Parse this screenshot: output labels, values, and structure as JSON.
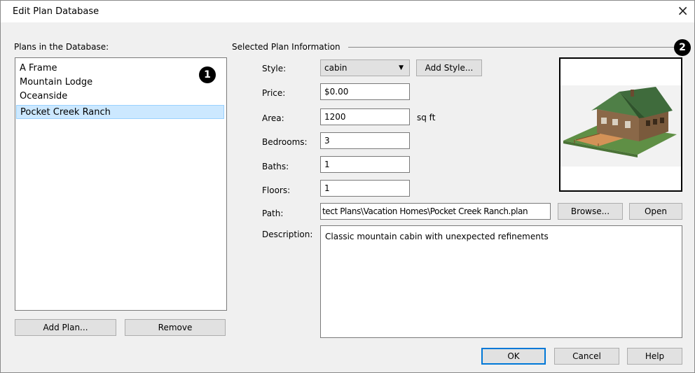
{
  "window": {
    "title": "Edit Plan Database",
    "close_glyph": "×"
  },
  "plans": {
    "header": "Plans in the Database:",
    "items": [
      "A Frame",
      "Mountain Lodge",
      "Oceanside",
      "Pocket Creek Ranch"
    ],
    "selected": "Pocket Creek Ranch",
    "add_label": "Add Plan...",
    "remove_label": "Remove"
  },
  "info": {
    "header": "Selected Plan Information",
    "style_label": "Style:",
    "style_value": "cabin",
    "add_style_label": "Add Style...",
    "price_label": "Price:",
    "price_value": "$0.00",
    "area_label": "Area:",
    "area_value": "1200",
    "area_unit": "sq ft",
    "bedrooms_label": "Bedrooms:",
    "bedrooms_value": "3",
    "baths_label": "Baths:",
    "baths_value": "1",
    "floors_label": "Floors:",
    "floors_value": "1",
    "path_label": "Path:",
    "path_value": "tect Plans\\Vacation Homes\\Pocket Creek Ranch.plan",
    "browse_label": "Browse...",
    "open_label": "Open",
    "description_label": "Description:",
    "description_value": "Classic mountain cabin with unexpected refinements"
  },
  "callouts": {
    "one": "1",
    "two": "2"
  },
  "footer": {
    "ok_label": "OK",
    "cancel_label": "Cancel",
    "help_label": "Help"
  },
  "colors": {
    "selection": "#cce8ff",
    "default_border": "#0078d7",
    "roof": "#3f6b3c",
    "lawn": "#6a9a4a",
    "deck": "#c8884a",
    "wall": "#8a6a4a"
  }
}
